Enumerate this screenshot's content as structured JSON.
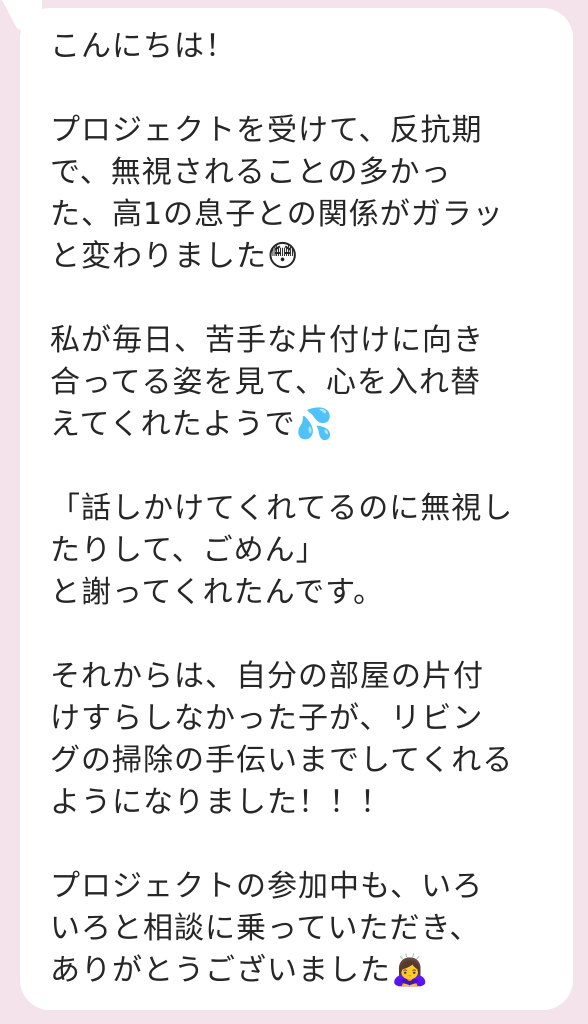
{
  "background_color": "#f4e3ea",
  "bubble_color": "#ffffff",
  "text_color": "#262626",
  "message": {
    "lines": [
      "こんにちは！",
      "",
      "プロジェクトを受けて、反抗期",
      "で、無視されることの多かっ",
      "た、高1の息子との関係がガラッ",
      "と変わりました😳",
      "",
      "私が毎日、苦手な片付けに向き",
      "合ってる姿を見て、心を入れ替",
      "えてくれたようで💦",
      "",
      "「話しかけてくれてるのに無視し",
      "たりして、ごめん」",
      "と謝ってくれたんです。",
      "",
      "それからは、自分の部屋の片付",
      "けすらしなかった子が、リビン",
      "グの掃除の手伝いまでしてくれる",
      "ようになりました！！！",
      "",
      "プロジェクトの参加中も、いろ",
      "いろと相談に乗っていただき、",
      "ありがとうございました🙇‍♀️"
    ]
  }
}
